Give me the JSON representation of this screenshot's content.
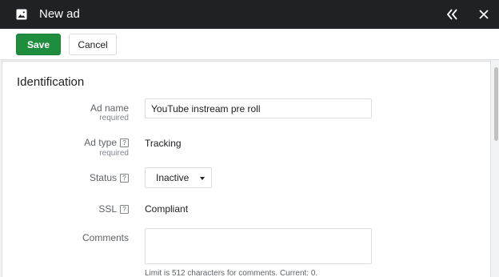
{
  "header": {
    "title": "New ad",
    "icons": {
      "ad": "image-icon",
      "collapse": "double-chevron-left-icon",
      "close": "close-icon"
    }
  },
  "toolbar": {
    "save_label": "Save",
    "cancel_label": "Cancel"
  },
  "colors": {
    "titlebar": "#202124",
    "save": "#1e8e3e",
    "card": "#ffffff",
    "background": "#f1f3f4"
  },
  "section": {
    "title": "Identification",
    "fields": {
      "ad_name": {
        "label": "Ad name",
        "sub": "required",
        "value": "YouTube instream pre roll"
      },
      "ad_type": {
        "label": "Ad type",
        "sub": "required",
        "value": "Tracking",
        "help": "?"
      },
      "status": {
        "label": "Status",
        "value": "Inactive",
        "help": "?"
      },
      "ssl": {
        "label": "SSL",
        "value": "Compliant",
        "help": "?"
      },
      "comments": {
        "label": "Comments",
        "value": "",
        "hint": "Limit is 512 characters for comments. Current: 0."
      }
    }
  }
}
